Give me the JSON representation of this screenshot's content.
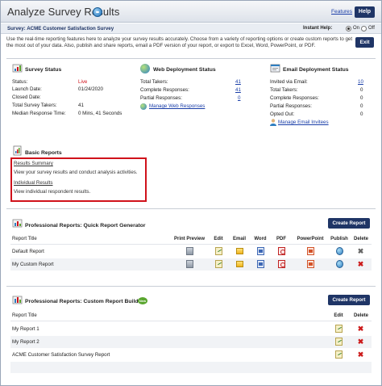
{
  "header": {
    "title": "Analyze Survey Results",
    "features_link": "Features",
    "help_button": "Help",
    "survey_label": "Survey: ACME Customer Satisfaction Survey",
    "instant_help_label": "Instant Help:",
    "instant_help_on": "On",
    "instant_help_off": "Off",
    "instant_help_selected": "On"
  },
  "intro": {
    "text": "Use the real-time reporting features here to analyze your survey results accurately. Choose from a variety of reporting options or create custom reports to get the most out of your data. Also, publish and share reports, email a PDF version of your report, or export to Excel, Word, PowerPoint, or PDF.",
    "exit_button": "Exit"
  },
  "survey_status": {
    "title": "Survey Status",
    "rows": [
      {
        "label": "Status:",
        "value": "Live"
      },
      {
        "label": "Launch Date:",
        "value": "01/24/2020"
      },
      {
        "label": "Closed Date:",
        "value": ""
      },
      {
        "label": "Total Survey Takers:",
        "value": "41"
      },
      {
        "label": "Median Response Time:",
        "value": "0 Mins, 41 Seconds"
      }
    ]
  },
  "web_deployment": {
    "title": "Web Deployment Status",
    "rows": [
      {
        "label": "Total Takers:",
        "value": "41"
      },
      {
        "label": "Complete Responses:",
        "value": "41"
      },
      {
        "label": "Partial Responses:",
        "value": "0"
      }
    ],
    "manage_link": "Manage Web Responses"
  },
  "email_deployment": {
    "title": "Email Deployment Status",
    "rows": [
      {
        "label": "Invited via Email:",
        "value": "10"
      },
      {
        "label": "Total Takers:",
        "value": "0"
      },
      {
        "label": "Complete Responses:",
        "value": "0"
      },
      {
        "label": "Partial Responses:",
        "value": "0"
      },
      {
        "label": "Opted Out:",
        "value": "0"
      }
    ],
    "manage_link": "Manage Email Invitees"
  },
  "basic_reports": {
    "title": "Basic Reports",
    "results_summary_link": "Results Summary",
    "results_summary_desc": "View your survey results and conduct analysis activities.",
    "individual_results_link": "Individual Results",
    "individual_results_desc": "View individual respondent results."
  },
  "quick_reports": {
    "title": "Professional Reports: Quick Report Generator",
    "create_button": "Create Report",
    "columns": [
      "Report Title",
      "Print Preview",
      "Edit",
      "Email",
      "Word",
      "PDF",
      "PowerPoint",
      "Publish",
      "Delete"
    ],
    "rows": [
      {
        "title": "Default Report"
      },
      {
        "title": "My Custom Report"
      }
    ]
  },
  "custom_reports": {
    "title": "Professional Reports: Custom Report Builder",
    "new_badge": "New",
    "create_button": "Create Report",
    "columns": [
      "Report Title",
      "Edit",
      "Delete"
    ],
    "rows": [
      {
        "title": "My Report 1"
      },
      {
        "title": "My Report 2"
      },
      {
        "title": "ACME Customer Satisfaction Survey Report"
      }
    ]
  },
  "colors": {
    "button_navy": "#1f3566",
    "link_blue": "#1a3ea8",
    "live_red": "#d0121b",
    "highlight_box": "#d0121b"
  }
}
